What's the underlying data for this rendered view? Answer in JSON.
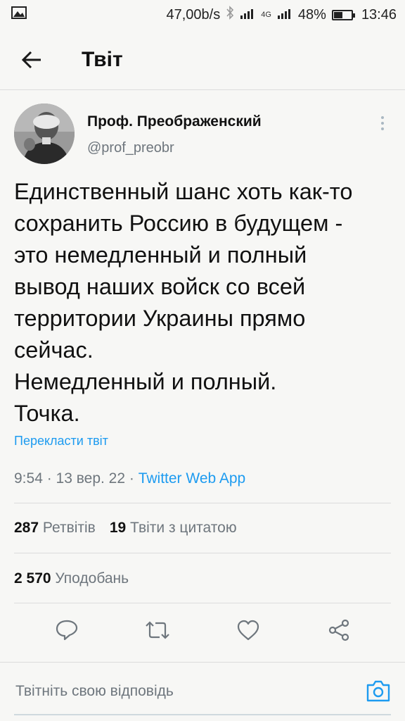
{
  "status_bar": {
    "speed": "47,00b/s",
    "network_label": "4G",
    "battery_percent": "48%",
    "battery_level": 0.48,
    "time": "13:46"
  },
  "header": {
    "title": "Твіт"
  },
  "tweet": {
    "author_name": "Проф. Преображенский",
    "author_handle": "@prof_preobr",
    "text_lines": [
      "Единственный шанс хоть как-то",
      "сохранить Россию в будущем -",
      "это немедленный и полный",
      "вывод наших войск со всей",
      "территории Украины прямо",
      "сейчас.",
      "Немедленный и полный.",
      "Точка."
    ],
    "translate_label": "Перекласти твіт",
    "timestamp": "9:54 · 13 вер. 22 · ",
    "source": "Twitter Web App",
    "retweets_count": "287",
    "retweets_label": "Ретвітів",
    "quotes_count": "19",
    "quotes_label": "Твіти з цитатою",
    "likes_count": "2 570",
    "likes_label": "Уподобань"
  },
  "reply": {
    "placeholder": "Твітніть свою відповідь"
  },
  "colors": {
    "accent": "#1d9bf0",
    "background": "#f7f7f5",
    "secondary_text": "#6e767d"
  },
  "icons": [
    "image-icon",
    "bluetooth-icon",
    "signal-icon",
    "battery-icon",
    "back-arrow-icon",
    "more-vertical-icon",
    "reply-icon",
    "retweet-icon",
    "like-icon",
    "share-icon",
    "camera-icon"
  ]
}
